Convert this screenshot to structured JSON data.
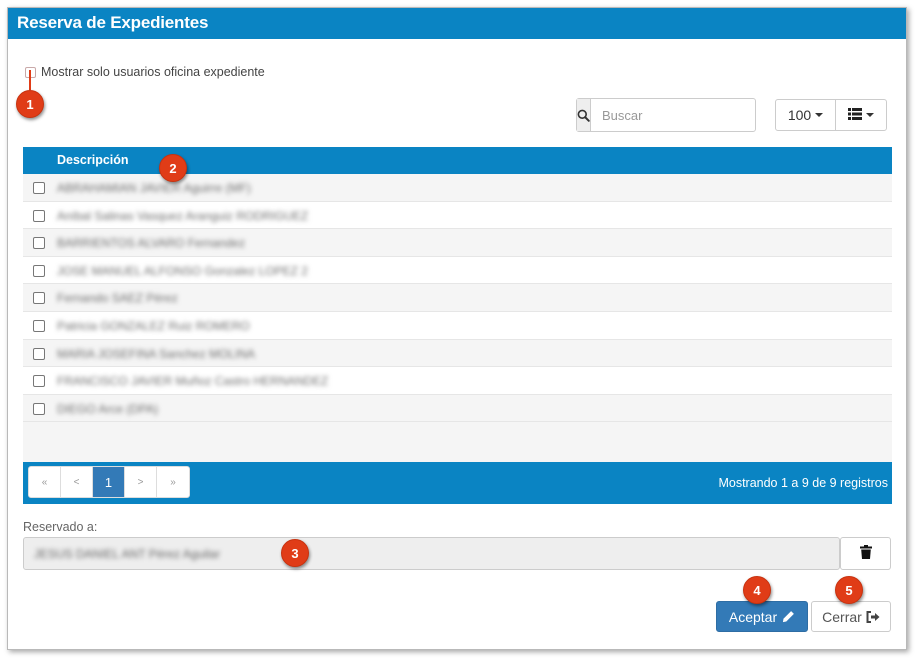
{
  "dialog": {
    "title": "Reserva de Expedientes",
    "accent_color": "#0a84c3",
    "badge_color": "#e03c17"
  },
  "filter": {
    "checkbox_label": "Mostrar solo usuarios oficina expediente",
    "checked": false
  },
  "toolbar": {
    "search_placeholder": "Buscar",
    "page_size": "100",
    "search_icon": "search-icon",
    "columns_icon": "list-icon"
  },
  "table": {
    "header": "Descripción",
    "rows": [
      {
        "text": "ABRAHAMIAN JAVIER Aguirre (MF)"
      },
      {
        "text": "Aníbal Salinas Vasquez Aranguiz RODRIGUEZ"
      },
      {
        "text": "BARRIENTOS ALVARO Fernandez"
      },
      {
        "text": "JOSE MANUEL ALFONSO Gonzalez LOPEZ 2"
      },
      {
        "text": "Fernando SAEZ Pérez"
      },
      {
        "text": "Patricia GONZALEZ Ruiz ROMERO"
      },
      {
        "text": "MARIA JOSEFINA Sanchez MOLINA"
      },
      {
        "text": "FRANCISCO JAVIER Muñoz Castro HERNANDEZ"
      },
      {
        "text": "DIEGO Arce (DPA)"
      }
    ]
  },
  "pagination": {
    "first": "«",
    "prev": "<",
    "current": "1",
    "next": ">",
    "last": "»",
    "summary": "Mostrando 1 a 9 de 9 registros"
  },
  "reserved": {
    "label": "Reservado a:",
    "value": "JESUS DANIEL ANT Pérez Aguilar",
    "clear_icon": "trash-icon"
  },
  "actions": {
    "accept_label": "Aceptar",
    "accept_icon": "pencil-icon",
    "close_label": "Cerrar",
    "close_icon": "sign-out-icon"
  },
  "callouts": [
    "1",
    "2",
    "3",
    "4",
    "5"
  ]
}
